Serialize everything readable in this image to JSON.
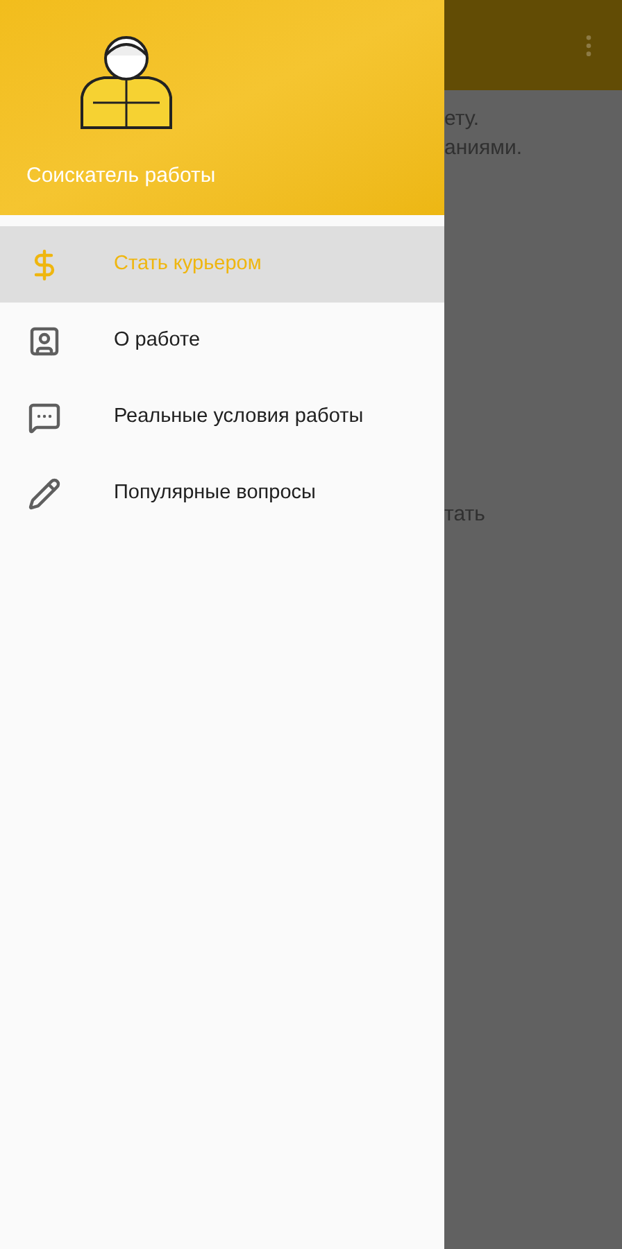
{
  "drawer": {
    "header": {
      "title": "Соискатель работы"
    },
    "items": [
      {
        "kind": "dollar",
        "label": "Стать курьером",
        "selected": true
      },
      {
        "kind": "badge",
        "label": "О работе",
        "selected": false
      },
      {
        "kind": "chat",
        "label": "Реальные условия работы",
        "selected": false
      },
      {
        "kind": "pencil",
        "label": "Популярные вопросы",
        "selected": false
      }
    ]
  },
  "background": {
    "lines": [
      "ету.",
      "аниями."
    ],
    "lower_text": "тать"
  }
}
